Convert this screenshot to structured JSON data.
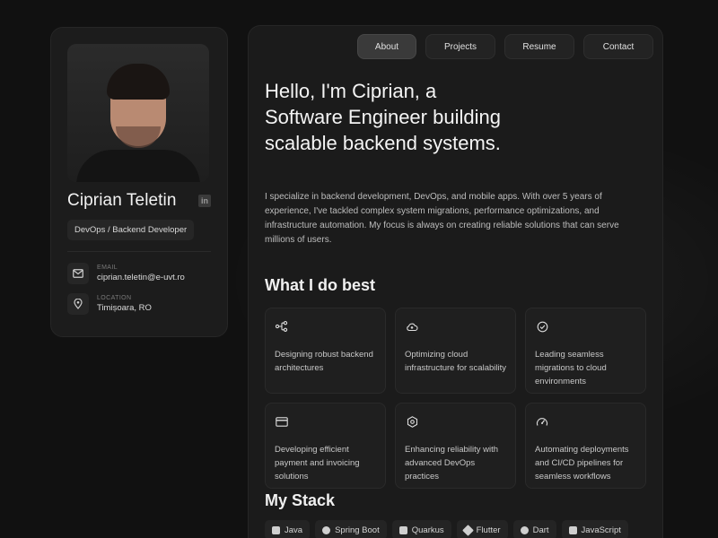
{
  "profile": {
    "name": "Ciprian Teletin",
    "role": "DevOps / Backend Developer",
    "linkedin_icon_text": "in",
    "email": {
      "label": "EMAIL",
      "value": "ciprian.teletin@e-uvt.ro",
      "icon": "mail-icon"
    },
    "location": {
      "label": "LOCATION",
      "value": "Timișoara, RO",
      "icon": "map-pin-icon"
    }
  },
  "nav": {
    "items": [
      {
        "label": "About",
        "active": true
      },
      {
        "label": "Projects",
        "active": false
      },
      {
        "label": "Resume",
        "active": false
      },
      {
        "label": "Contact",
        "active": false
      }
    ]
  },
  "hero": {
    "line1": "Hello, I'm Ciprian, a",
    "line2": "Software Engineer building",
    "line3": "scalable backend systems.",
    "intro": "I specialize in backend development, DevOps, and mobile apps. With over 5 years of experience, I've tackled complex system migrations, performance optimizations, and infrastructure automation. My focus is always on creating reliable solutions that can serve millions of users."
  },
  "services": {
    "title": "What I do best",
    "items": [
      {
        "icon": "network-icon",
        "text": "Designing robust backend architectures"
      },
      {
        "icon": "cloud-icon",
        "text": "Optimizing cloud infrastructure for scalability"
      },
      {
        "icon": "check-circle-icon",
        "text": "Leading seamless migrations to cloud environments"
      },
      {
        "icon": "credit-card-icon",
        "text": "Developing efficient payment and invoicing solutions"
      },
      {
        "icon": "hexagon-icon",
        "text": "Enhancing reliability with advanced DevOps practices"
      },
      {
        "icon": "gauge-icon",
        "text": "Automating deployments and CI/CD pipelines for seamless workflows"
      }
    ]
  },
  "stack": {
    "title": "My Stack",
    "items": [
      "Java",
      "Spring Boot",
      "Quarkus",
      "Flutter",
      "Dart",
      "JavaScript"
    ]
  }
}
